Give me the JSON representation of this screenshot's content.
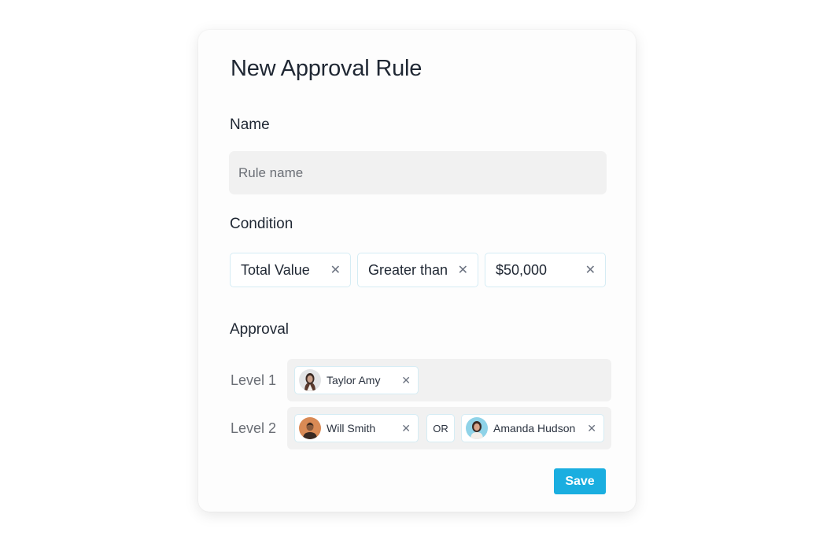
{
  "form": {
    "title": "New Approval Rule",
    "name_label": "Name",
    "name_placeholder": "Rule name",
    "name_value": "",
    "condition_label": "Condition",
    "conditions": [
      {
        "label": "Total Value",
        "remove_icon": "close-icon"
      },
      {
        "label": "Greater than",
        "remove_icon": "close-icon"
      },
      {
        "label": "$50,000",
        "remove_icon": "close-icon"
      }
    ],
    "approval_label": "Approval",
    "levels": [
      {
        "label": "Level 1",
        "approvers": [
          {
            "name": "Taylor Amy"
          }
        ]
      },
      {
        "label": "Level 2",
        "approvers": [
          {
            "name": "Will Smith"
          },
          {
            "name": "Amanda Hudson"
          }
        ],
        "connector": "OR"
      }
    ],
    "save_label": "Save"
  },
  "colors": {
    "accent": "#1aaee0",
    "chip_border": "#d5ecf4",
    "input_bg": "#f1f1f1"
  }
}
